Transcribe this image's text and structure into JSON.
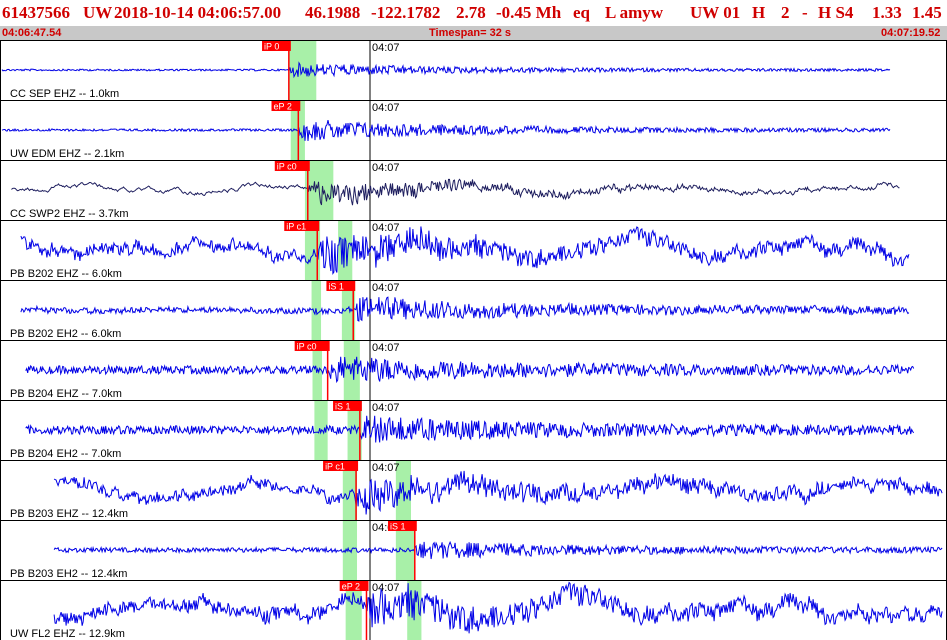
{
  "header": {
    "event_id": "61437566",
    "network": "UW",
    "datetime": "2018-10-14 04:06:57.00",
    "lat": "46.1988",
    "lon": "-122.1782",
    "depth": "2.78",
    "magnitude": "-0.45 Mh",
    "etype": "eq",
    "flags": "L amyw",
    "source": "UW 01",
    "quality": "H",
    "nsta": "2",
    "dash": "-",
    "hs": "H S4",
    "rms": "1.33",
    "err": "1.45"
  },
  "subheader": {
    "start_time": "04:06:47.54",
    "timespan": "Timespan=  32 s",
    "end_time": "04:07:19.52"
  },
  "colors": {
    "trace": "#0000e6",
    "trace_dark": "#202060",
    "pick_fill": "#ff0000",
    "pick_text": "#ffffff",
    "window": "#a8f0a8",
    "header_text": "#d00000",
    "subbar_bg": "#c8c8c8"
  },
  "minute_label": "04:07",
  "panels": [
    {
      "label": "CC SEP EHZ -- 1.0km",
      "picks": [
        {
          "text": "iP 0",
          "frac": 0.305
        }
      ],
      "windows": [
        [
          0.305,
          0.334
        ]
      ],
      "amp": 0.18,
      "noise": 0.03,
      "lp": 0.0,
      "color": "trace",
      "trace_start": 0.0,
      "trace_end": 0.94
    },
    {
      "label": "UW EDM EHZ -- 2.1km",
      "picks": [
        {
          "text": "eP 2",
          "frac": 0.315
        }
      ],
      "windows": [
        [
          0.307,
          0.322
        ]
      ],
      "amp": 0.28,
      "noise": 0.04,
      "lp": 0.0,
      "color": "trace",
      "trace_start": 0.0,
      "trace_end": 0.94
    },
    {
      "label": "CC SWP2 EHZ -- 3.7km",
      "picks": [
        {
          "text": "iP c0",
          "frac": 0.325
        }
      ],
      "windows": [
        [
          0.322,
          0.352
        ]
      ],
      "amp": 0.36,
      "noise": 0.0,
      "lp": 0.2,
      "color": "trace_dark",
      "trace_start": 0.01,
      "trace_end": 0.95
    },
    {
      "label": "PB B202 EHZ -- 6.0km",
      "picks": [
        {
          "text": "iP c1",
          "frac": 0.335
        }
      ],
      "windows": [
        [
          0.322,
          0.338
        ],
        [
          0.357,
          0.372
        ]
      ],
      "amp": 0.35,
      "noise": 0.18,
      "lp": 0.35,
      "color": "trace",
      "trace_start": 0.02,
      "trace_end": 0.96
    },
    {
      "label": "PB B202 EH2 -- 6.0km",
      "picks": [
        {
          "text": "iS 1",
          "frac": 0.373
        }
      ],
      "windows": [
        [
          0.329,
          0.339
        ],
        [
          0.361,
          0.375
        ]
      ],
      "amp": 0.28,
      "noise": 0.1,
      "lp": 0.05,
      "color": "trace",
      "trace_start": 0.02,
      "trace_end": 0.96
    },
    {
      "label": "PB B204 EHZ -- 7.0km",
      "picks": [
        {
          "text": "iP c0",
          "frac": 0.346
        }
      ],
      "windows": [
        [
          0.33,
          0.34
        ],
        [
          0.363,
          0.38
        ]
      ],
      "amp": 0.3,
      "noise": 0.14,
      "lp": 0.0,
      "color": "trace",
      "trace_start": 0.025,
      "trace_end": 0.965
    },
    {
      "label": "PB B204 EH2 -- 7.0km",
      "picks": [
        {
          "text": "iS 1",
          "frac": 0.38
        }
      ],
      "windows": [
        [
          0.332,
          0.346
        ],
        [
          0.367,
          0.382
        ]
      ],
      "amp": 0.3,
      "noise": 0.14,
      "lp": 0.0,
      "color": "trace",
      "trace_start": 0.025,
      "trace_end": 0.965
    },
    {
      "label": "PB B203 EHZ -- 12.4km",
      "picks": [
        {
          "text": "iP c1",
          "frac": 0.376
        }
      ],
      "windows": [
        [
          0.362,
          0.377
        ],
        [
          0.418,
          0.434
        ]
      ],
      "amp": 0.32,
      "noise": 0.16,
      "lp": 0.3,
      "color": "trace",
      "trace_start": 0.055,
      "trace_end": 0.995
    },
    {
      "label": "PB B203 EH2 -- 12.4km",
      "picks": [
        {
          "text": "iS 1",
          "frac": 0.438
        }
      ],
      "windows": [
        [
          0.362,
          0.377
        ],
        [
          0.418,
          0.438
        ]
      ],
      "amp": 0.2,
      "noise": 0.08,
      "lp": 0.0,
      "color": "trace",
      "trace_start": 0.055,
      "trace_end": 0.995
    },
    {
      "label": "UW FL2 EHZ -- 12.9km",
      "picks": [
        {
          "text": "eP 2",
          "frac": 0.387
        }
      ],
      "windows": [
        [
          0.365,
          0.382
        ],
        [
          0.43,
          0.445
        ]
      ],
      "amp": 0.38,
      "noise": 0.2,
      "lp": 0.4,
      "color": "trace",
      "trace_start": 0.055,
      "trace_end": 0.995
    }
  ]
}
